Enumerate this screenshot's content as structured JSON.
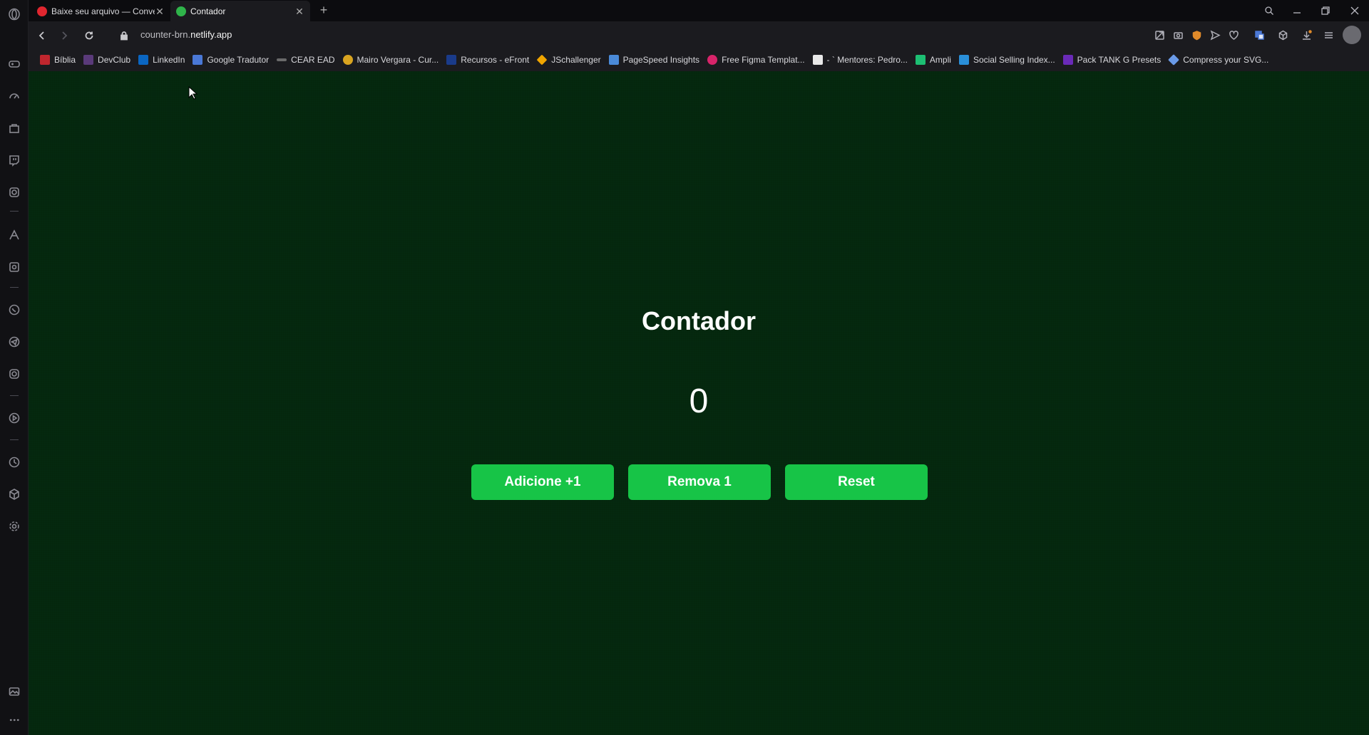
{
  "browser": {
    "tabs": [
      {
        "title": "Baixe seu arquivo — Conve",
        "active": false,
        "favicon_color": "#e0262f"
      },
      {
        "title": "Contador",
        "active": true,
        "favicon_color": "#2fb44a"
      }
    ],
    "url_prefix": "counter-brn.",
    "url_domain": "netlify.app",
    "bookmarks": [
      {
        "label": "Bíblia",
        "color": "#c0262e"
      },
      {
        "label": "DevClub",
        "color": "#5a3a7a"
      },
      {
        "label": "LinkedIn",
        "color": "#0a66c2"
      },
      {
        "label": "Google Tradutor",
        "color": "#4a78d6"
      },
      {
        "label": "CEAR EAD",
        "color": "#6a6a6a"
      },
      {
        "label": "Mairo Vergara - Cur...",
        "color": "#d9a420"
      },
      {
        "label": "Recursos - eFront",
        "color": "#1a3b8a"
      },
      {
        "label": "JSchallenger",
        "color": "#f0a500"
      },
      {
        "label": "PageSpeed Insights",
        "color": "#4a8ad8"
      },
      {
        "label": "Free Figma Templat...",
        "color": "#d8246a"
      },
      {
        "label": "- ` Mentores: Pedro...",
        "color": "#e8e8e8"
      },
      {
        "label": "Ampli",
        "color": "#1dbf73"
      },
      {
        "label": "Social Selling Index...",
        "color": "#2a8fd8"
      },
      {
        "label": "Pack TANK G Presets",
        "color": "#6a2ab8"
      },
      {
        "label": "Compress your SVG...",
        "color": "#6a9ae8"
      }
    ]
  },
  "app": {
    "title": "Contador",
    "count": "0",
    "buttons": {
      "add": "Adicione +1",
      "remove": "Remova 1",
      "reset": "Reset"
    },
    "accent_color": "#17c447",
    "background_color": "#05290f"
  }
}
